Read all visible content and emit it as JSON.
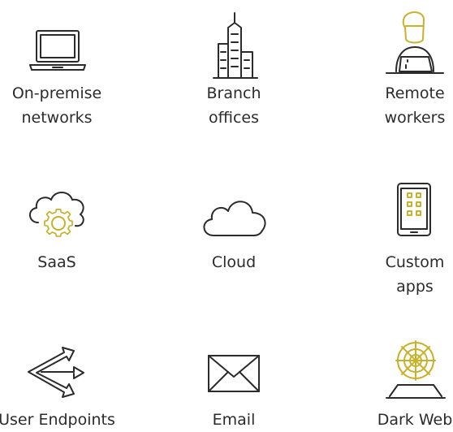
{
  "items": [
    {
      "label": "On-premise\nnetworks",
      "icon": "laptop-icon"
    },
    {
      "label": "Branch\noffices",
      "icon": "building-icon"
    },
    {
      "label": "Remote\nworkers",
      "icon": "remote-worker-icon"
    },
    {
      "label": "SaaS",
      "icon": "cloud-gear-icon"
    },
    {
      "label": "Cloud",
      "icon": "cloud-icon"
    },
    {
      "label": "Custom\napps",
      "icon": "tablet-apps-icon"
    },
    {
      "label": "User Endpoints",
      "icon": "arrows-endpoints-icon"
    },
    {
      "label": "Email",
      "icon": "envelope-icon"
    },
    {
      "label": "Dark Web",
      "icon": "spiderweb-laptop-icon"
    }
  ],
  "colors": {
    "text": "#2b2b2b",
    "accent": "#c9b12a"
  }
}
